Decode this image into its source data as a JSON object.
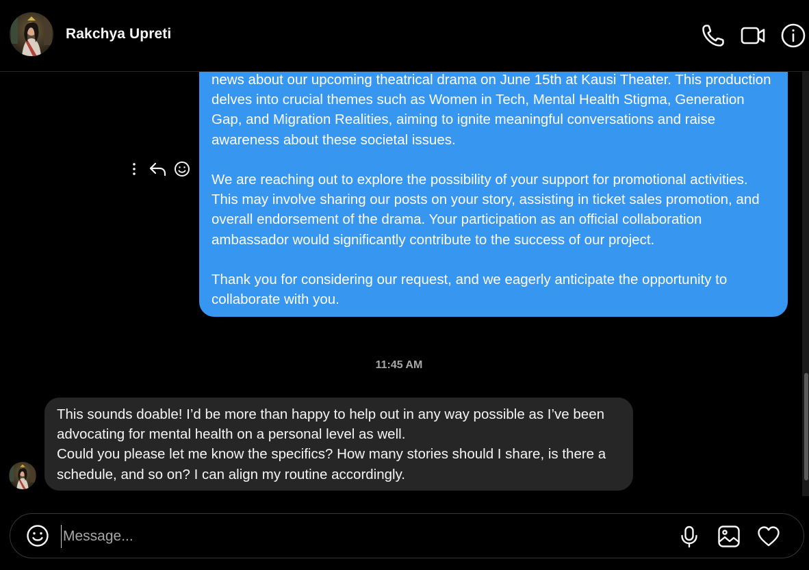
{
  "header": {
    "contact_name": "Rakchya Upreti",
    "avatar_icon": "profile-photo",
    "actions": [
      {
        "name": "call",
        "icon": "phone-icon"
      },
      {
        "name": "video-call",
        "icon": "video-camera-icon"
      },
      {
        "name": "conversation-info",
        "icon": "info-icon"
      }
    ]
  },
  "messages": {
    "outgoing": {
      "paragraphs": [
        "news about our upcoming theatrical drama on June 15th at Kausi Theater. This production delves into crucial themes such as Women in Tech, Mental Health Stigma, Generation Gap, and Migration Realities, aiming to ignite meaningful conversations and raise awareness about these societal issues.",
        "We are reaching out to explore the possibility of your support for promotional activities. This may involve sharing our posts on your story, assisting in ticket sales promotion, and overall endorsement of the drama. Your participation as an official collaboration ambassador would significantly contribute to the success of our project.",
        "Thank you for considering our request, and we eagerly anticipate the opportunity to collaborate with you."
      ],
      "color": "#3797f0"
    },
    "actions": [
      {
        "name": "more-options",
        "icon": "vertical-dots-icon"
      },
      {
        "name": "reply",
        "icon": "reply-arrow-icon"
      },
      {
        "name": "react",
        "icon": "smiley-icon"
      }
    ],
    "timestamp": "11:45 AM",
    "incoming": {
      "lines": [
        "This sounds doable! I’d be more than happy to help out in any way possible as I’ve been advocating for mental health on a personal level as well.",
        "Could you please let me know the specifics? How many stories should I share, is there a schedule, and so on? I can align my routine accordingly."
      ],
      "color": "#262626"
    }
  },
  "composer": {
    "placeholder": "Message...",
    "value": "",
    "icons": [
      "emoji-icon",
      "microphone-icon",
      "image-icon",
      "heart-icon"
    ]
  },
  "theme": {
    "background": "#000000",
    "secondary_text": "#a8a8a8"
  }
}
